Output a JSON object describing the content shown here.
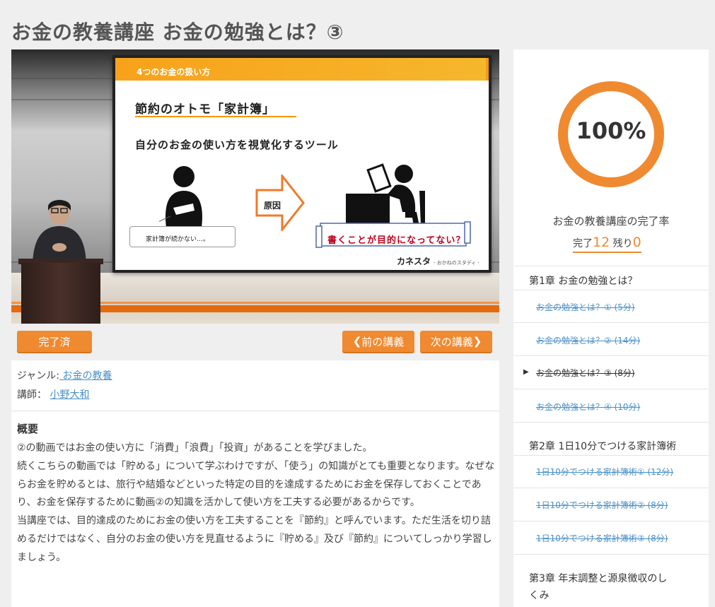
{
  "page": {
    "title": "お金の教養講座 お金の勉強とは？③"
  },
  "video": {
    "slide_header": "4つのお金の扱い方",
    "slide_title": "節約のオトモ「家計簿」",
    "slide_subtitle": "自分のお金の使い方を視覚化するツール",
    "callout": "家計簿が続かない…。",
    "arrow_label": "原因",
    "scroll_text": "書くことが目的になってない？",
    "brand": "カネスタ",
    "brand_sub": "- おかねのスタディ -"
  },
  "controls": {
    "done_label": "完了済",
    "prev_label": "前の講義",
    "next_label": "次の講義"
  },
  "info": {
    "genre_label": "ジャンル:",
    "genre_value": " お金の教養",
    "teacher_label": "講師：",
    "teacher_value": "小野大和",
    "summary_title": "概要",
    "summary_p1": "②の動画ではお金の使い方に「消費」「浪費」「投資」があることを学びました。",
    "summary_p2": "続くこちらの動画では「貯める」について学ぶわけですが、「使う」の知識がとても重要となります。なぜならお金を貯めるとは、旅行や結婚などといった特定の目的を達成するためにお金を保存しておくことであり、お金を保存するために動画②の知識を活かして使い方を工夫する必要があるからです。",
    "summary_p3": "当講座では、目的達成のためにお金の使い方を工夫することを『節約』と呼んでいます。ただ生活を切り詰めるだけではなく、自分のお金の使い方を見直せるように『貯める』及び『節約』についてしっかり学習しましょう。"
  },
  "progress": {
    "percent_text": "100%",
    "percent": 100,
    "label": "お金の教養講座の完了率",
    "done_label": "完了",
    "done_count": "12",
    "remain_label": "残り",
    "remain_count": "0"
  },
  "chapters": [
    {
      "title": "第1章 お金の勉強とは？",
      "lessons": [
        "お金の勉強とは？① (5分)",
        "お金の勉強とは？② (14分)",
        "お金の勉強とは？③ (8分)",
        "お金の勉強とは？④ (10分)"
      ]
    },
    {
      "title": "第2章 1日10分でつける家計簿術",
      "lessons": [
        "1日10分でつける家計簿術① (12分)",
        "1日10分でつける家計簿術② (8分)",
        "1日10分でつける家計簿術③ (8分)"
      ]
    },
    {
      "title_line1": "第3章 年末調整と源泉徴収のし",
      "title_line2": "くみ"
    }
  ],
  "colors": {
    "accent": "#ef8a30",
    "link": "#4a90c8",
    "background": "#efefef"
  }
}
